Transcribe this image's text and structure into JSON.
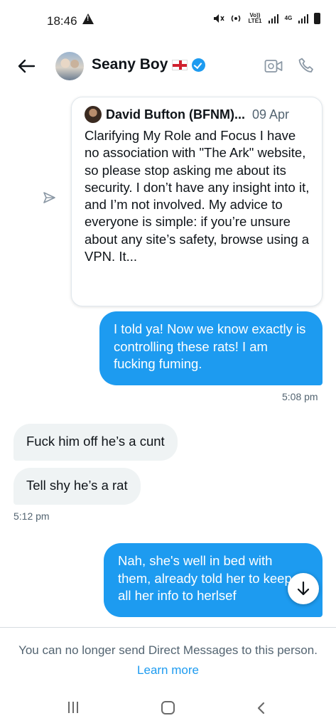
{
  "status_bar": {
    "time": "18:46",
    "network_label": "4G",
    "volte_label": "Vo)) LTE1"
  },
  "header": {
    "contact_name": "Seany Boy",
    "icons": [
      "back-arrow-icon",
      "avatar",
      "england-flag",
      "verified-badge-icon",
      "video-call-icon",
      "phone-call-icon"
    ]
  },
  "quote": {
    "author": "David Bufton (BFNM)...",
    "date": "09 Apr",
    "text": "Clarifying My Role and Focus I have no association with \"The Ark\" website, so please stop asking me about its security. I don’t have any insight into it, and I’m not involved. My advice to everyone is simple: if you’re unsure about any site’s safety, browse using a VPN. It..."
  },
  "messages": [
    {
      "direction": "outgoing",
      "text": "I told ya! Now we know exactly is controlling these rats! I am fucking fuming."
    },
    {
      "direction": "outgoing-time",
      "text": "5:08 pm"
    },
    {
      "direction": "incoming",
      "text": "Fuck him off he’s a cunt"
    },
    {
      "direction": "incoming",
      "text": "Tell shy he’s a rat"
    },
    {
      "direction": "incoming-time",
      "text": "5:12 pm"
    },
    {
      "direction": "outgoing",
      "text": "Nah, she's well in bed with them, already told her to keep all her info to herlsef"
    }
  ],
  "footer": {
    "notice": "You can no longer send Direct Messages to this person.",
    "learn_more": "Learn more"
  },
  "colors": {
    "accent": "#1d9bf0",
    "incoming_bubble": "#eff3f4",
    "secondary_text": "#536471"
  }
}
